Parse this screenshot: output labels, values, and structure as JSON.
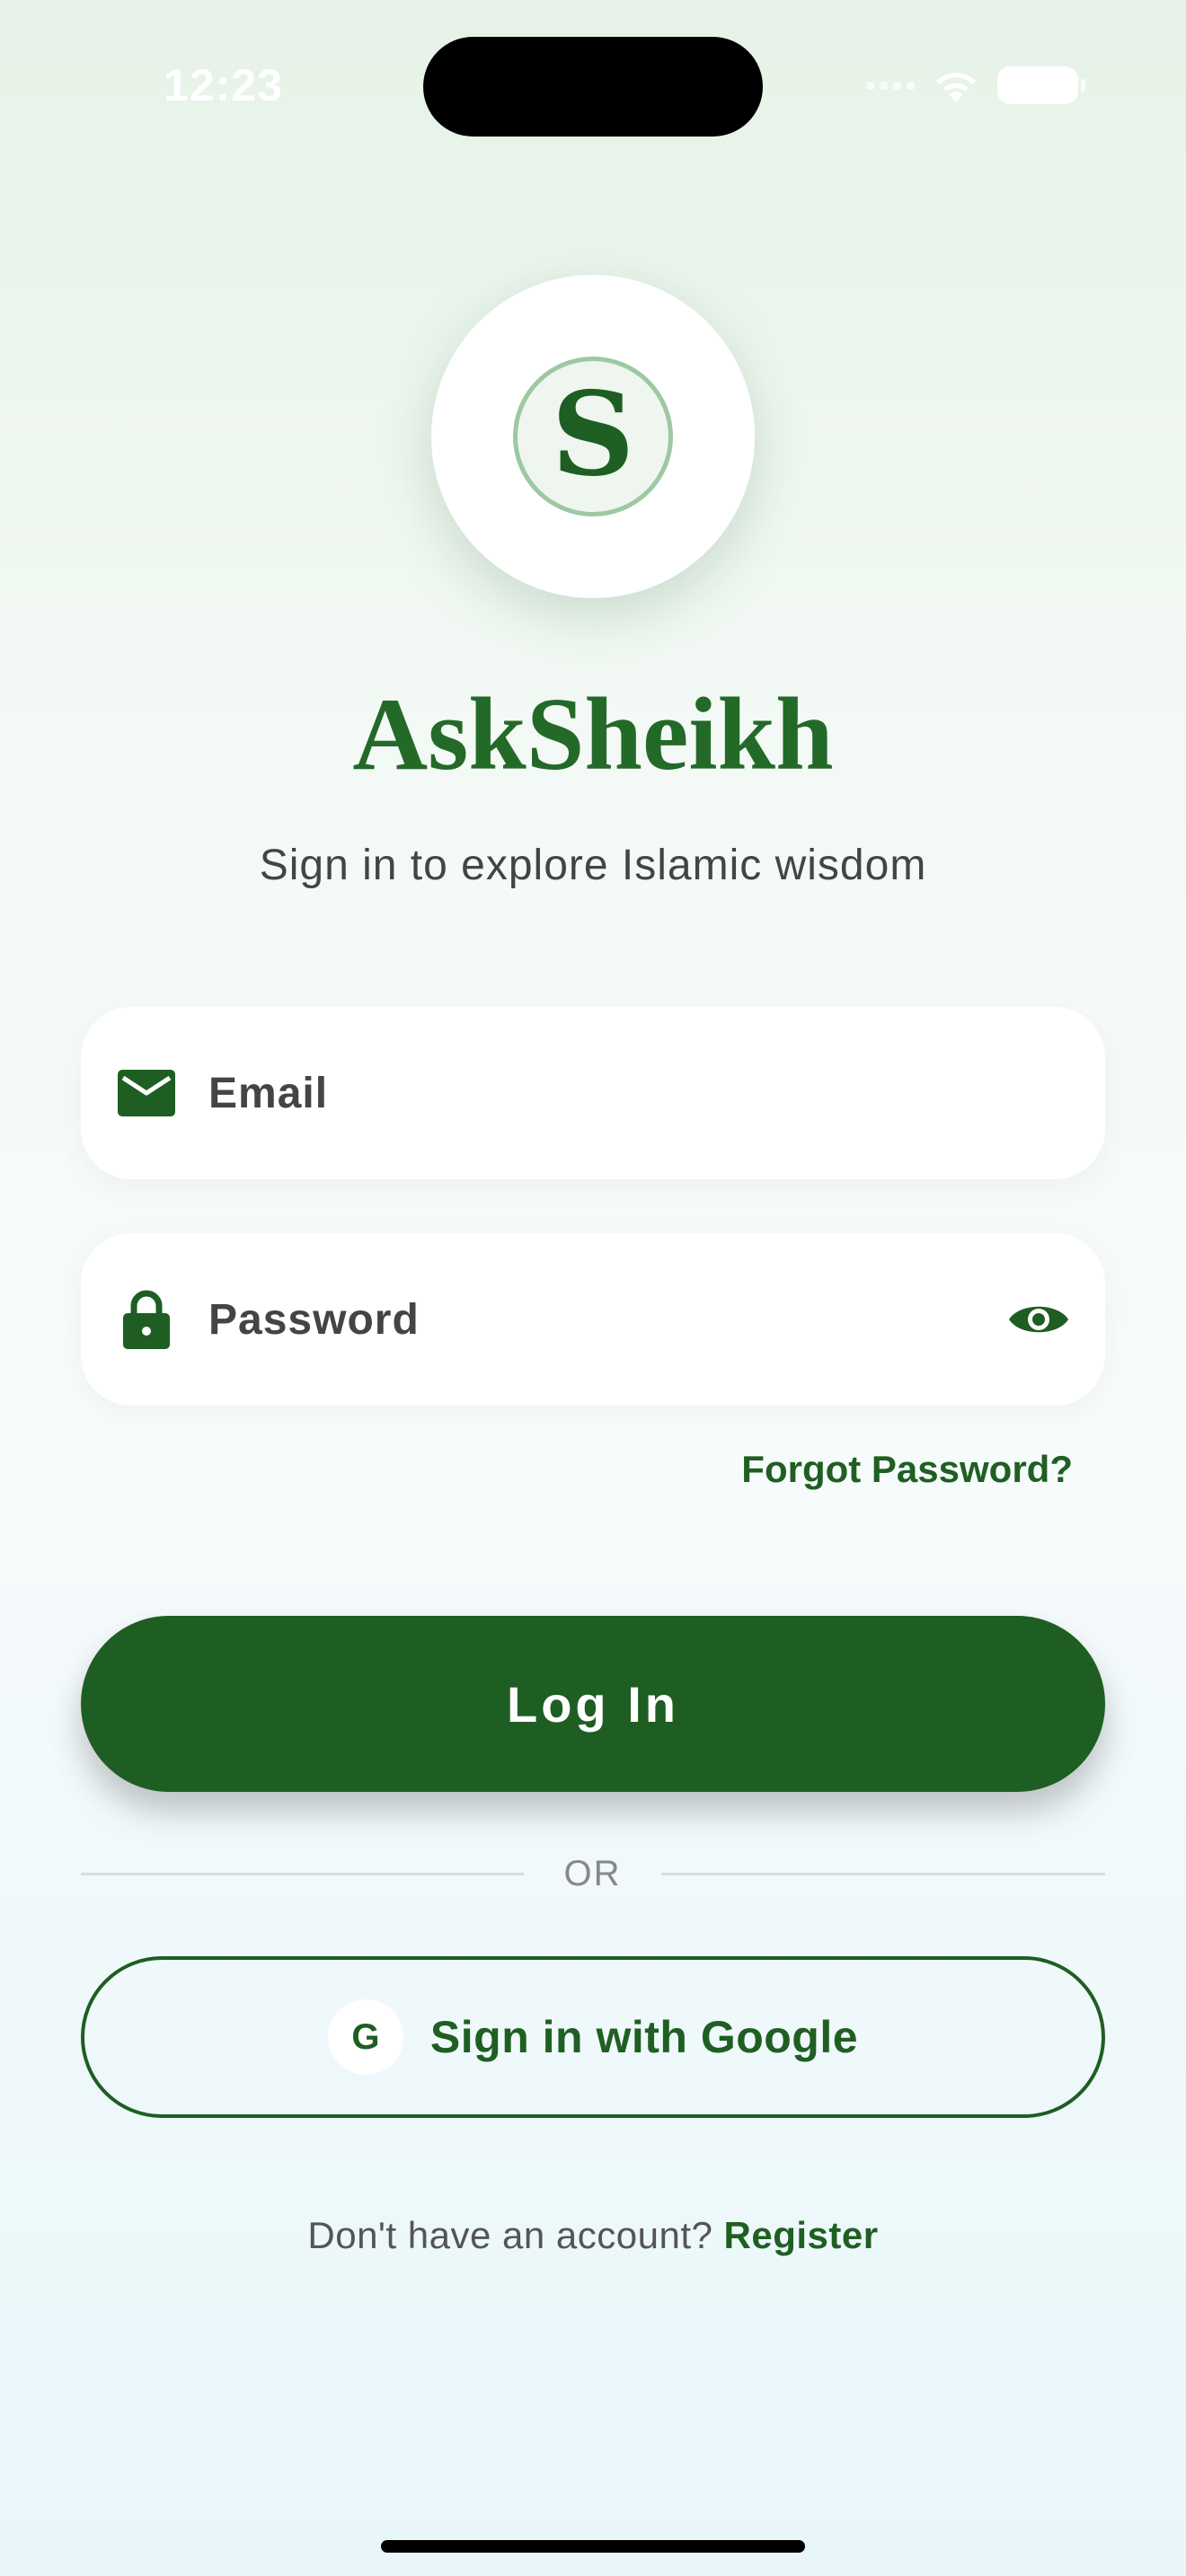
{
  "status_bar": {
    "time": "12:23"
  },
  "logo": {
    "letter": "S"
  },
  "app_title": "AskSheikh",
  "subtitle": "Sign in to explore Islamic wisdom",
  "email_field": {
    "placeholder": "Email",
    "icon": "mail-icon"
  },
  "password_field": {
    "placeholder": "Password",
    "icon": "lock-icon",
    "toggle_icon": "eye-icon"
  },
  "forgot_password": "Forgot Password?",
  "login_button": "Log In",
  "divider_label": "OR",
  "google_button": {
    "icon_letter": "G",
    "label": "Sign in with Google"
  },
  "register": {
    "prompt": "Don't have an account?",
    "link": "Register"
  },
  "colors": {
    "primary": "#1e5e22",
    "title": "#236a29",
    "background_top": "#e6f2e7",
    "background_bottom": "#e8f6fa"
  }
}
